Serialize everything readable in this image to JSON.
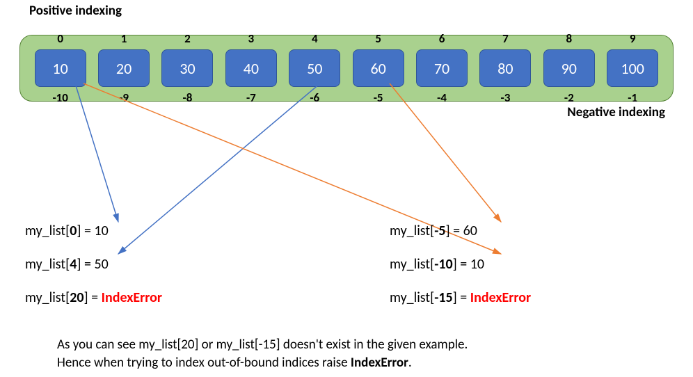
{
  "titles": {
    "positive": "Positive indexing",
    "negative": "Negative indexing"
  },
  "list": [
    {
      "pos": "0",
      "neg": "-10",
      "val": "10"
    },
    {
      "pos": "1",
      "neg": "-9",
      "val": "20"
    },
    {
      "pos": "2",
      "neg": "-8",
      "val": "30"
    },
    {
      "pos": "3",
      "neg": "-7",
      "val": "40"
    },
    {
      "pos": "4",
      "neg": "-6",
      "val": "50"
    },
    {
      "pos": "5",
      "neg": "-5",
      "val": "60"
    },
    {
      "pos": "6",
      "neg": "-4",
      "val": "70"
    },
    {
      "pos": "7",
      "neg": "-3",
      "val": "80"
    },
    {
      "pos": "8",
      "neg": "-2",
      "val": "90"
    },
    {
      "pos": "9",
      "neg": "-1",
      "val": "100"
    }
  ],
  "examples_left": [
    {
      "expr_pre": "my_list[",
      "idx": "0",
      "expr_post": "] = ",
      "result": "10",
      "error": false
    },
    {
      "expr_pre": "my_list[",
      "idx": "4",
      "expr_post": "] = ",
      "result": "50",
      "error": false
    },
    {
      "expr_pre": "my_list[",
      "idx": "20",
      "expr_post": "] =  ",
      "result": "IndexError",
      "error": true
    }
  ],
  "examples_right": [
    {
      "expr_pre": "my_list[",
      "idx": "-5",
      "expr_post": "] = ",
      "result": "60",
      "error": false
    },
    {
      "expr_pre": "my_list[",
      "idx": "-10",
      "expr_post": "] = ",
      "result": "10",
      "error": false
    },
    {
      "expr_pre": "my_list[",
      "idx": "-15",
      "expr_post": "] = ",
      "result": "IndexError",
      "error": true
    }
  ],
  "explanation": {
    "line1_a": "As you can see my_list[20] or my_list[-15] doesn't exist in the given example.",
    "line2_a": "Hence when trying to index out-of-bound indices raise ",
    "line2_b": "IndexError",
    "line2_c": "."
  },
  "chart_data": {
    "type": "table",
    "title": "Python list indexing (positive and negative)",
    "list_values": [
      10,
      20,
      30,
      40,
      50,
      60,
      70,
      80,
      90,
      100
    ],
    "positive_indices": [
      0,
      1,
      2,
      3,
      4,
      5,
      6,
      7,
      8,
      9
    ],
    "negative_indices": [
      -10,
      -9,
      -8,
      -7,
      -6,
      -5,
      -4,
      -3,
      -2,
      -1
    ],
    "lookups": [
      {
        "index": 0,
        "result": 10
      },
      {
        "index": 4,
        "result": 50
      },
      {
        "index": 20,
        "result": "IndexError"
      },
      {
        "index": -5,
        "result": 60
      },
      {
        "index": -10,
        "result": 10
      },
      {
        "index": -15,
        "result": "IndexError"
      }
    ]
  }
}
